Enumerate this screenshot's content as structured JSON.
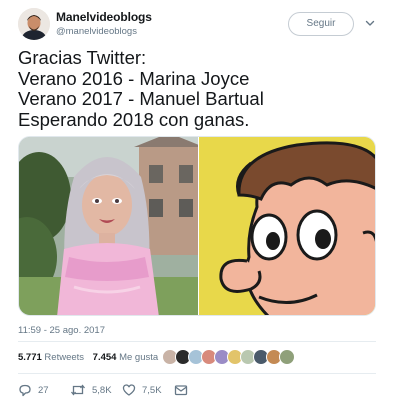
{
  "user": {
    "name": "Manelvideoblogs",
    "handle": "@manelvideoblogs"
  },
  "follow_label": "Seguir",
  "tweet": {
    "lines": [
      "Gracias Twitter:",
      "Verano 2016 - Marina Joyce",
      "Verano 2017 - Manuel Bartual",
      "Esperando 2018 con ganas."
    ]
  },
  "timestamp": "11:59 - 25 ago. 2017",
  "stats": {
    "retweets_count": "5.771",
    "retweets_label": "Retweets",
    "likes_count": "7.454",
    "likes_label": "Me gusta"
  },
  "actions": {
    "reply_count": "27",
    "retweet_count": "5,8K",
    "like_count": "7,5K"
  },
  "icons": {
    "chevron": "chevron-down-icon",
    "reply": "reply-icon",
    "retweet": "retweet-icon",
    "like": "heart-icon",
    "dm": "envelope-icon"
  },
  "colors": {
    "text": "#14171a",
    "secondary": "#657786",
    "border": "#e6ecf0",
    "cartoon_bg": "#e8d84a"
  }
}
